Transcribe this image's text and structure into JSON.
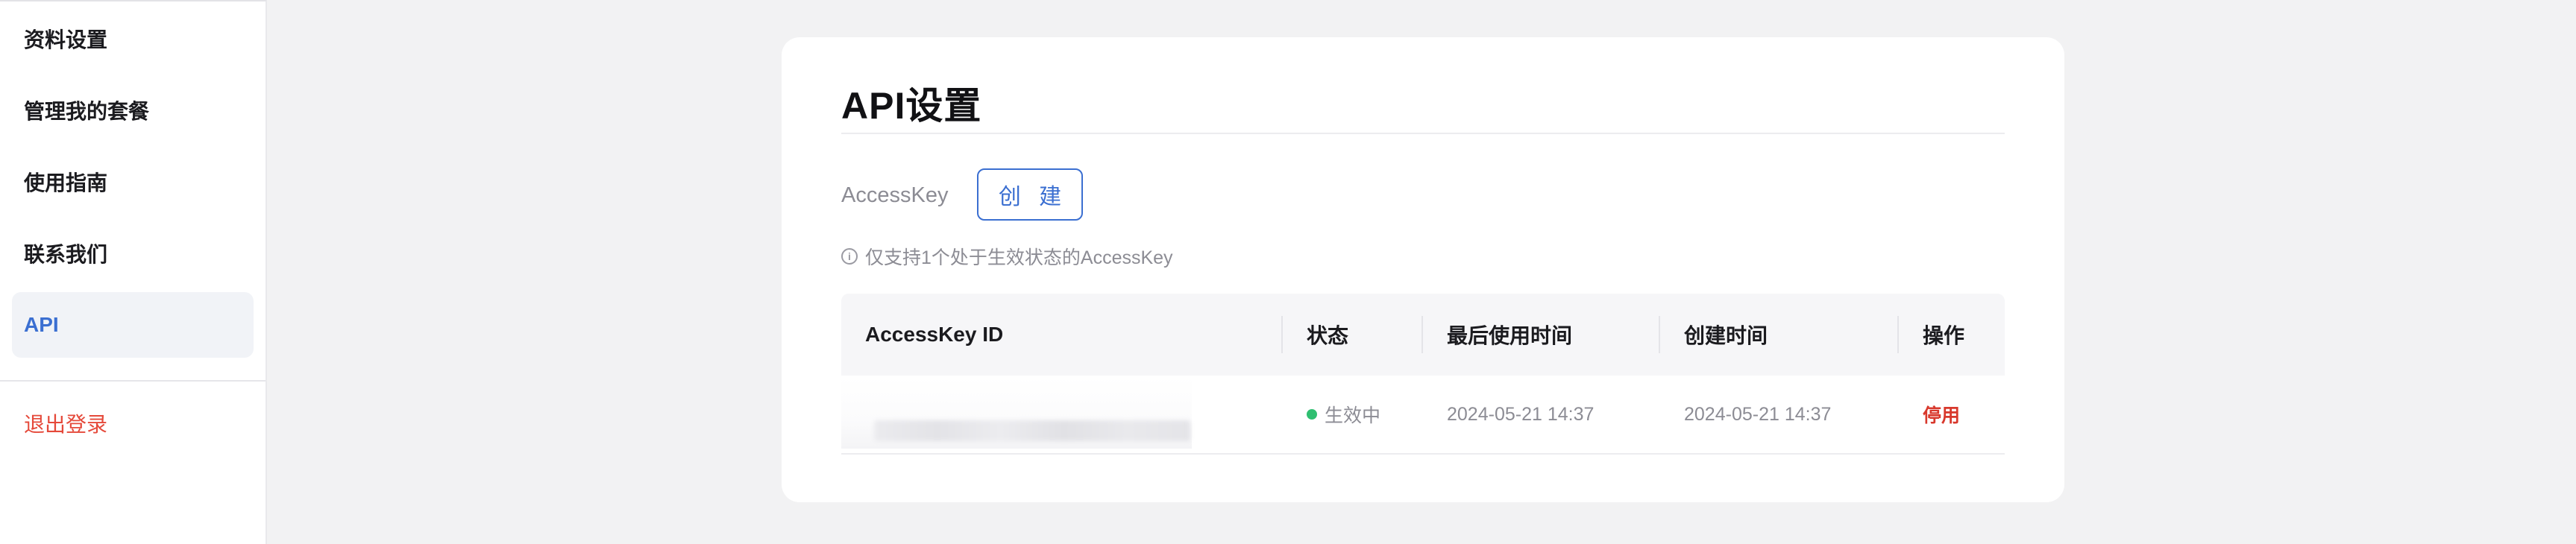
{
  "sidebar": {
    "items": [
      {
        "label": "资料设置"
      },
      {
        "label": "管理我的套餐"
      },
      {
        "label": "使用指南"
      },
      {
        "label": "联系我们"
      },
      {
        "label": "API"
      }
    ],
    "logout_label": "退出登录"
  },
  "page": {
    "title": "API设置",
    "accesskey_label": "AccessKey",
    "create_button": "创 建",
    "hint": "仅支持1个处于生效状态的AccessKey"
  },
  "table": {
    "columns": [
      "AccessKey ID",
      "状态",
      "最后使用时间",
      "创建时间",
      "操作"
    ],
    "rows": [
      {
        "status": "生效中",
        "last_used": "2024-05-21 14:37",
        "created": "2024-05-21 14:37",
        "action": "停用"
      }
    ]
  },
  "colors": {
    "accent": "#3b6fd1",
    "danger": "#d8382c",
    "status_active": "#2fbf71"
  },
  "icons": {
    "hint_icon": "info-circle-icon"
  }
}
